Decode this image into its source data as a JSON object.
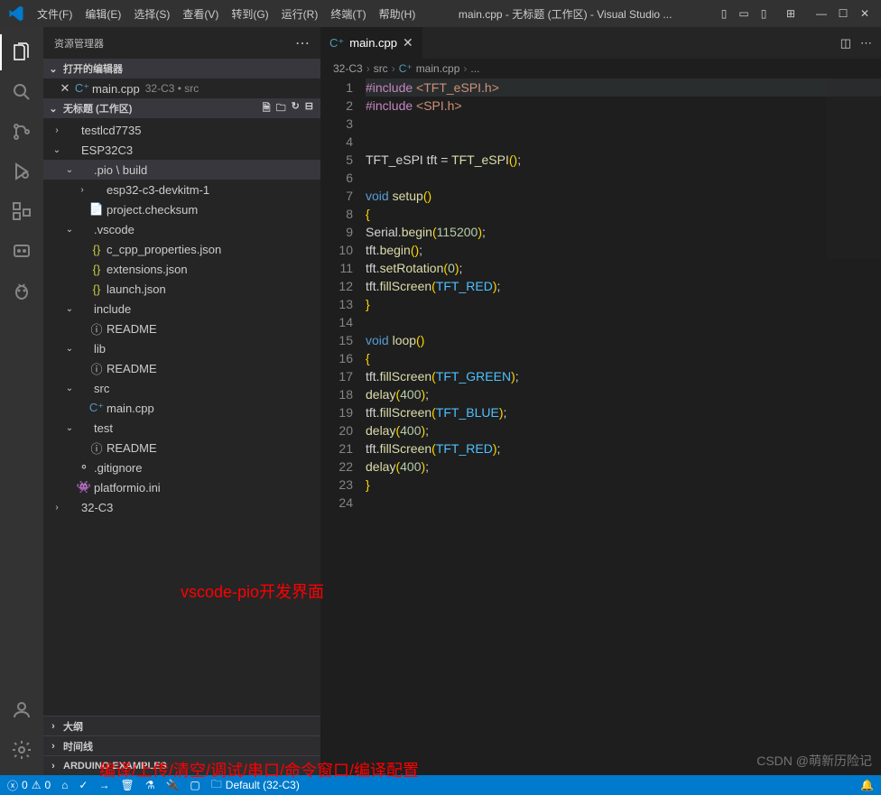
{
  "titlebar": {
    "menus": [
      "文件(F)",
      "编辑(E)",
      "选择(S)",
      "查看(V)",
      "转到(G)",
      "运行(R)",
      "终端(T)",
      "帮助(H)"
    ],
    "title": "main.cpp - 无标题 (工作区) - Visual Studio ..."
  },
  "sidebar": {
    "header": "资源管理器",
    "open_editors_label": "打开的编辑器",
    "open_file": {
      "name": "main.cpp",
      "tail": "32-C3 • src"
    },
    "workspace_label": "无标题 (工作区)",
    "tree": [
      {
        "indent": 0,
        "chev": "›",
        "name": "testlcd7735",
        "type": "folder"
      },
      {
        "indent": 0,
        "chev": "⌄",
        "name": "ESP32C3",
        "type": "folder"
      },
      {
        "indent": 1,
        "chev": "⌄",
        "name": ".pio \\ build",
        "type": "folder-path",
        "selected": true
      },
      {
        "indent": 2,
        "chev": "›",
        "name": "esp32-c3-devkitm-1",
        "type": "folder"
      },
      {
        "indent": 2,
        "chev": "",
        "name": "project.checksum",
        "type": "file",
        "icon": "📄"
      },
      {
        "indent": 1,
        "chev": "⌄",
        "name": ".vscode",
        "type": "folder"
      },
      {
        "indent": 2,
        "chev": "",
        "name": "c_cpp_properties.json",
        "type": "json",
        "icon": "{}"
      },
      {
        "indent": 2,
        "chev": "",
        "name": "extensions.json",
        "type": "json",
        "icon": "{}"
      },
      {
        "indent": 2,
        "chev": "",
        "name": "launch.json",
        "type": "json",
        "icon": "{}"
      },
      {
        "indent": 1,
        "chev": "⌄",
        "name": "include",
        "type": "folder"
      },
      {
        "indent": 2,
        "chev": "",
        "name": "README",
        "type": "file",
        "icon": "ⓘ"
      },
      {
        "indent": 1,
        "chev": "⌄",
        "name": "lib",
        "type": "folder"
      },
      {
        "indent": 2,
        "chev": "",
        "name": "README",
        "type": "file",
        "icon": "ⓘ"
      },
      {
        "indent": 1,
        "chev": "⌄",
        "name": "src",
        "type": "folder"
      },
      {
        "indent": 2,
        "chev": "",
        "name": "main.cpp",
        "type": "cpp",
        "icon": "C⁺"
      },
      {
        "indent": 1,
        "chev": "⌄",
        "name": "test",
        "type": "folder"
      },
      {
        "indent": 2,
        "chev": "",
        "name": "README",
        "type": "file",
        "icon": "ⓘ"
      },
      {
        "indent": 1,
        "chev": "",
        "name": ".gitignore",
        "type": "file",
        "icon": "⚬"
      },
      {
        "indent": 1,
        "chev": "",
        "name": "platformio.ini",
        "type": "file",
        "icon": "👾"
      },
      {
        "indent": 0,
        "chev": "›",
        "name": "32-C3",
        "type": "folder"
      }
    ],
    "bottom_sections": [
      "大纲",
      "时间线",
      "ARDUINO EXAMPLES"
    ]
  },
  "editor": {
    "tab_name": "main.cpp",
    "breadcrumbs": [
      "32-C3",
      "src",
      "main.cpp",
      "..."
    ],
    "lines": [
      {
        "n": 1,
        "hl": true,
        "tokens": [
          {
            "t": "#include ",
            "c": "kw-pre"
          },
          {
            "t": "<TFT_eSPI.h>",
            "c": "str"
          }
        ]
      },
      {
        "n": 2,
        "tokens": [
          {
            "t": "#include ",
            "c": "kw-pre"
          },
          {
            "t": "<SPI.h>",
            "c": "str"
          }
        ]
      },
      {
        "n": 3,
        "tokens": []
      },
      {
        "n": 4,
        "tokens": []
      },
      {
        "n": 5,
        "tokens": [
          {
            "t": "TFT_eSPI tft ",
            "c": "op"
          },
          {
            "t": "=",
            "c": "op"
          },
          {
            "t": " ",
            "c": "op"
          },
          {
            "t": "TFT_eSPI",
            "c": "fn"
          },
          {
            "t": "()",
            "c": "pn"
          },
          {
            "t": ";",
            "c": "op"
          }
        ]
      },
      {
        "n": 6,
        "tokens": []
      },
      {
        "n": 7,
        "tokens": [
          {
            "t": "void ",
            "c": "kw-type"
          },
          {
            "t": "setup",
            "c": "fn"
          },
          {
            "t": "()",
            "c": "pn"
          }
        ]
      },
      {
        "n": 8,
        "tokens": [
          {
            "t": "{",
            "c": "pn"
          }
        ]
      },
      {
        "n": 9,
        "tokens": [
          {
            "t": "Serial.",
            "c": "op"
          },
          {
            "t": "begin",
            "c": "fn"
          },
          {
            "t": "(",
            "c": "pn"
          },
          {
            "t": "115200",
            "c": "num"
          },
          {
            "t": ")",
            "c": "pn"
          },
          {
            "t": ";",
            "c": "op"
          }
        ]
      },
      {
        "n": 10,
        "tokens": [
          {
            "t": "tft.",
            "c": "op"
          },
          {
            "t": "begin",
            "c": "fn"
          },
          {
            "t": "()",
            "c": "pn"
          },
          {
            "t": ";",
            "c": "op"
          }
        ]
      },
      {
        "n": 11,
        "tokens": [
          {
            "t": "tft.",
            "c": "op"
          },
          {
            "t": "setRotation",
            "c": "fn"
          },
          {
            "t": "(",
            "c": "pn"
          },
          {
            "t": "0",
            "c": "num"
          },
          {
            "t": ")",
            "c": "pn"
          },
          {
            "t": ";",
            "c": "op"
          }
        ]
      },
      {
        "n": 12,
        "tokens": [
          {
            "t": "tft.",
            "c": "op"
          },
          {
            "t": "fillScreen",
            "c": "fn"
          },
          {
            "t": "(",
            "c": "pn"
          },
          {
            "t": "TFT_RED",
            "c": "const"
          },
          {
            "t": ")",
            "c": "pn"
          },
          {
            "t": ";",
            "c": "op"
          }
        ]
      },
      {
        "n": 13,
        "tokens": [
          {
            "t": "}",
            "c": "pn"
          }
        ]
      },
      {
        "n": 14,
        "tokens": []
      },
      {
        "n": 15,
        "tokens": [
          {
            "t": "void ",
            "c": "kw-type"
          },
          {
            "t": "loop",
            "c": "fn"
          },
          {
            "t": "()",
            "c": "pn"
          }
        ]
      },
      {
        "n": 16,
        "tokens": [
          {
            "t": "{",
            "c": "pn"
          }
        ]
      },
      {
        "n": 17,
        "tokens": [
          {
            "t": "tft.",
            "c": "op"
          },
          {
            "t": "fillScreen",
            "c": "fn"
          },
          {
            "t": "(",
            "c": "pn"
          },
          {
            "t": "TFT_GREEN",
            "c": "const"
          },
          {
            "t": ")",
            "c": "pn"
          },
          {
            "t": ";",
            "c": "op"
          }
        ]
      },
      {
        "n": 18,
        "tokens": [
          {
            "t": "delay",
            "c": "fn"
          },
          {
            "t": "(",
            "c": "pn"
          },
          {
            "t": "400",
            "c": "num"
          },
          {
            "t": ")",
            "c": "pn"
          },
          {
            "t": ";",
            "c": "op"
          }
        ]
      },
      {
        "n": 19,
        "tokens": [
          {
            "t": "tft.",
            "c": "op"
          },
          {
            "t": "fillScreen",
            "c": "fn"
          },
          {
            "t": "(",
            "c": "pn"
          },
          {
            "t": "TFT_BLUE",
            "c": "const"
          },
          {
            "t": ")",
            "c": "pn"
          },
          {
            "t": ";",
            "c": "op"
          }
        ]
      },
      {
        "n": 20,
        "tokens": [
          {
            "t": "delay",
            "c": "fn"
          },
          {
            "t": "(",
            "c": "pn"
          },
          {
            "t": "400",
            "c": "num"
          },
          {
            "t": ")",
            "c": "pn"
          },
          {
            "t": ";",
            "c": "op"
          }
        ]
      },
      {
        "n": 21,
        "tokens": [
          {
            "t": "tft.",
            "c": "op"
          },
          {
            "t": "fillScreen",
            "c": "fn"
          },
          {
            "t": "(",
            "c": "pn"
          },
          {
            "t": "TFT_RED",
            "c": "const"
          },
          {
            "t": ")",
            "c": "pn"
          },
          {
            "t": ";",
            "c": "op"
          }
        ]
      },
      {
        "n": 22,
        "tokens": [
          {
            "t": "delay",
            "c": "fn"
          },
          {
            "t": "(",
            "c": "pn"
          },
          {
            "t": "400",
            "c": "num"
          },
          {
            "t": ")",
            "c": "pn"
          },
          {
            "t": ";",
            "c": "op"
          }
        ]
      },
      {
        "n": 23,
        "tokens": [
          {
            "t": "}",
            "c": "pn"
          }
        ]
      },
      {
        "n": 24,
        "tokens": []
      }
    ]
  },
  "statusbar": {
    "errors": "0",
    "warnings": "0",
    "env": "Default (32-C3)"
  },
  "annotations": {
    "a1": "vscode-pio开发界面",
    "a2": "编译/上传/清空/调试/串口/命令窗口/编译配置",
    "watermark": "CSDN @萌新历险记"
  }
}
